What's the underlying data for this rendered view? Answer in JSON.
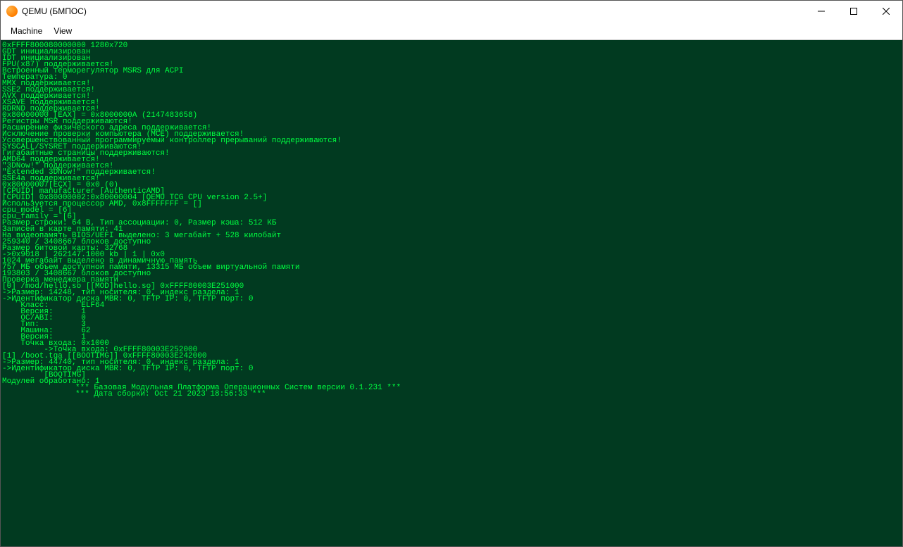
{
  "window": {
    "title": "QEMU (БМПОС)"
  },
  "menu": {
    "machine": "Machine",
    "view": "View"
  },
  "console": {
    "lines": [
      "0xFFFF800080000000 1280x720",
      "GDT инициализирован",
      "IDT инициализирован",
      "FPU(x87) поддерживается!",
      "Встроенный терморегулятор MSRS для ACPI",
      "Температура: 0",
      "MMX поддерживается!",
      "SSE2 поддерживается!",
      "AVX поддерживается!",
      "XSAVE поддерживается!",
      "RDRND поддерживается!",
      "0x80000000 [EAX] = 0x8000000A (2147483658)",
      "Регистры MSR поддерживаются!",
      "Расширение физического адреса поддерживается!",
      "Исключение проверки компьютера (MCE) поддерживается!",
      "Усовершенствованный программируемый контроллер прерываний поддерживаются!",
      "SYSCALL/SYSRET поддерживаются!",
      "Гигабайтные страницы поддерживаются!",
      "AMD64 поддерживается!",
      "\"3DNow!\" поддерживается!",
      "\"Extended 3DNow!\" поддерживается!",
      "SSE4a поддерживается!",
      "0x80000007[ECX] = 0x0 (0)",
      "[CPUID] manufacturer [AuthenticAMD]",
      "[CPUID] 0x80000002:0x80000004 [QEMU TCG CPU version 2.5+]",
      "Используется процессор AMD, 0x8FFFFFFF = []",
      "cpu_model = [6]",
      "cpu_family = [6]",
      "Размер строки: 64 B, Тип ассоциации: 0, Размер кэша: 512 КБ",
      "Записей в карте памяти: 41",
      "На видеопамять BIOS/UEFI выделено: 3 мегабайт + 528 килобайт",
      "259340 / 3408667 блоков доступно",
      "Размер битовой карты: 32768",
      "->0x9018 | 262147.1000 kb | 1 | 0x0",
      "1024 мегабайт выделено в динамичную память",
      "757 МБ объем доступной памяти, 13315 МБ объем виртуальной памяти",
      "193803 / 3408667 блоков доступно",
      "Проверка менеджера памяти",
      "[0] /mod/hello.so [[MOD]hello.so] 0xFFFF80003E251000",
      "->Размер: 14248, тип носителя: 0, индекс раздела: 1",
      "->Идентификатор диска MBR: 0, TFTP IP: 0, TFTP порт: 0",
      "    Класс:       ELF64",
      "    Версия:      1",
      "    ОС/ABI:      0",
      "    Тип:         3",
      "    Машина:      62",
      "    Версия:      1",
      "    Точка входа: 0x1000",
      "         ->Точка входа: 0xFFFF80003E252000",
      "[1] /boot.tga [[BOOTIMG]] 0xFFFF80003E242000",
      "->Размер: 44740, тип носителя: 0, индекс раздела: 1",
      "->Идентификатор диска MBR: 0, TFTP IP: 0, TFTP порт: 0",
      "         [BOOTIMG]",
      "Модулей обработано: 1"
    ],
    "banner1": "*** Базовая Модульная Платформа Операционных Систем версии 0.1.231 ***",
    "banner2": "*** Дата сборки: Oct 21 2023 18:56:33 ***"
  }
}
